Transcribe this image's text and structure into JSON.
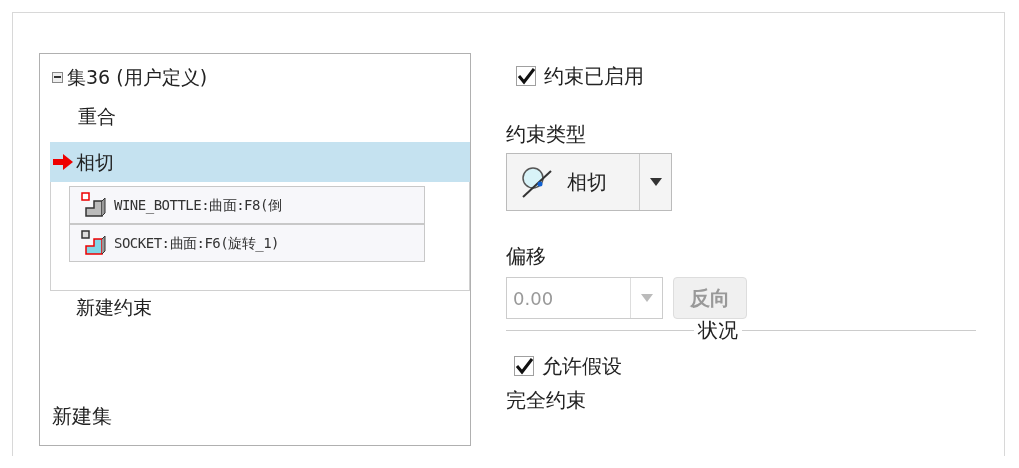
{
  "tree": {
    "sets": [
      {
        "label": "集36 (用户定义)",
        "expanded": true,
        "constraints": [
          {
            "label": "重合",
            "selected": false
          },
          {
            "label": "相切",
            "selected": true,
            "references": [
              {
                "text": "WINE_BOTTLE:曲面:F8(倒",
                "kind": "bottle"
              },
              {
                "text": "SOCKET:曲面:F6(旋转_1)",
                "kind": "socket"
              }
            ]
          }
        ],
        "new_constraint": "新建约束"
      }
    ],
    "new_set": "新建集"
  },
  "enabled": {
    "label": "约束已启用",
    "checked": true
  },
  "constraint_type": {
    "label": "约束类型",
    "value": "相切"
  },
  "offset": {
    "label": "偏移",
    "value": "0.00",
    "disabled": true,
    "flip_button": "反向"
  },
  "status": {
    "title": "状况",
    "allow_assumptions": {
      "label": "允许假设",
      "checked": true
    },
    "text": "完全约束"
  }
}
